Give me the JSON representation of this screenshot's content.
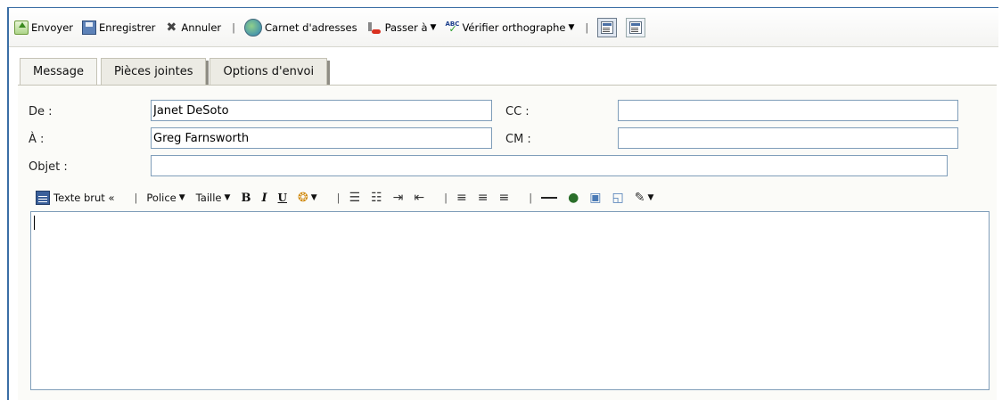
{
  "toolbar": {
    "send": "Envoyer",
    "save": "Enregistrer",
    "cancel": "Annuler",
    "address_book": "Carnet d'adresses",
    "goto": "Passer à",
    "spellcheck": "Vérifier orthographe",
    "sep": "|"
  },
  "tabs": [
    {
      "label": "Message",
      "active": true
    },
    {
      "label": "Pièces jointes",
      "active": false
    },
    {
      "label": "Options d'envoi",
      "active": false
    }
  ],
  "form": {
    "from_label": "De :",
    "from_value": "Janet DeSoto",
    "to_label": "À :",
    "to_value": "Greg Farnsworth",
    "subject_label": "Objet :",
    "subject_value": "",
    "cc_label": "CC :",
    "cc_value": "",
    "bcc_label": "CM :",
    "bcc_value": ""
  },
  "editor_toolbar": {
    "plain_text": "Texte brut «",
    "font": "Police",
    "size": "Taille",
    "bold": "B",
    "italic": "I",
    "underline": "U"
  },
  "colors": {
    "accent": "#3a6ea5",
    "field_border": "#7f9db9",
    "tab_bg": "#ecebe4"
  }
}
